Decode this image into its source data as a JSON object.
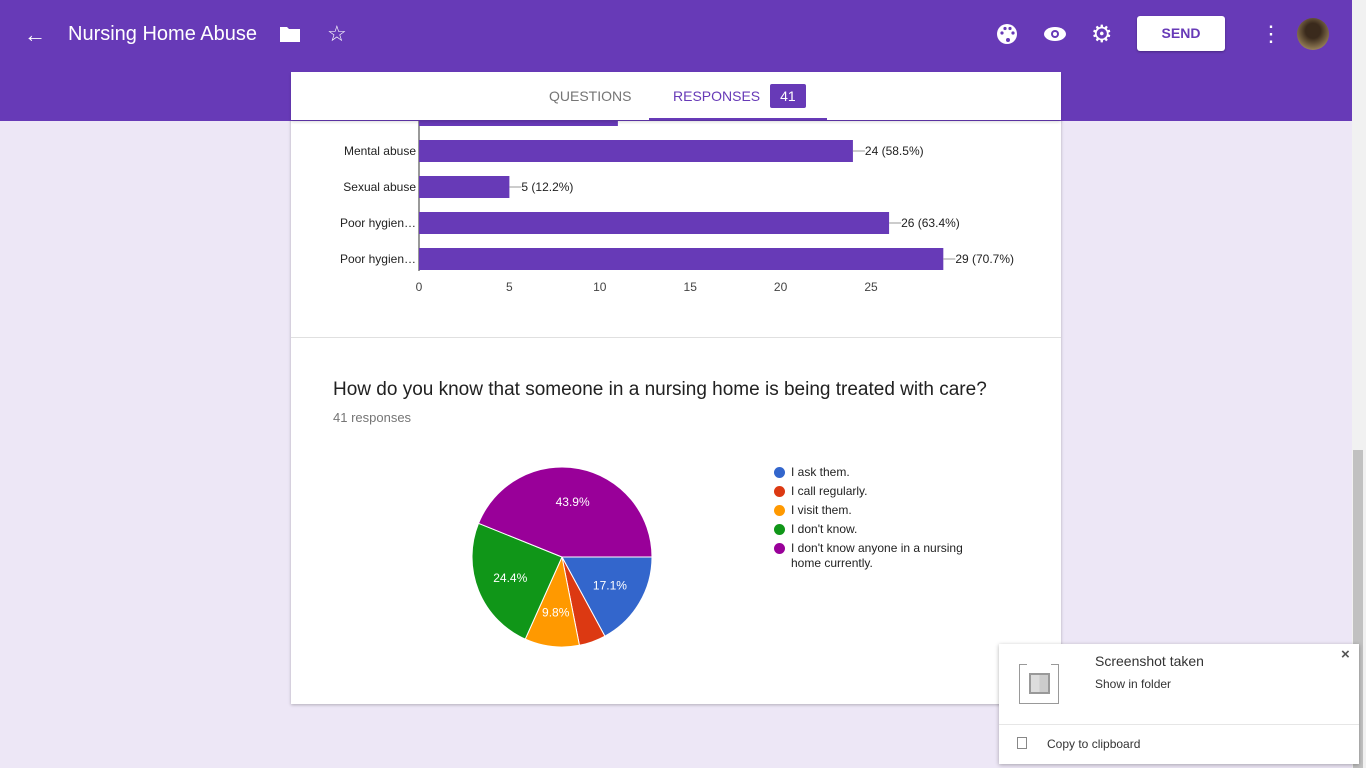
{
  "header": {
    "title": "Nursing Home Abuse",
    "send_label": "SEND",
    "icons": [
      "arrow-back-icon",
      "folder-icon",
      "star-outline-icon",
      "palette-icon",
      "eye-icon",
      "gear-icon",
      "more-vert-icon"
    ],
    "accent": "#673ab7"
  },
  "tabs": [
    {
      "label": "QUESTIONS"
    },
    {
      "label": "RESPONSES",
      "badge": "41",
      "active": true
    }
  ],
  "chart_data": [
    {
      "type": "bar",
      "orientation": "horizontal",
      "categories": [
        "",
        "Mental abuse",
        "Sexual abuse",
        "Poor hygien…",
        "Poor hygien…"
      ],
      "values": [
        11,
        24,
        5,
        26,
        29
      ],
      "labels": [
        "",
        "24 (58.5%)",
        "5 (12.2%)",
        "26 (63.4%)",
        "29 (70.7%)"
      ],
      "xticks": [
        "0",
        "5",
        "10",
        "15",
        "20",
        "25"
      ],
      "xlim": [
        0,
        30
      ],
      "color": "#673ab7"
    },
    {
      "type": "pie",
      "title": "How do you know that someone in a nursing home is being treated with care?",
      "subtitle": "41 responses",
      "slices": [
        {
          "name": "I ask them.",
          "value": 17.1,
          "label": "17.1%",
          "color": "#3366cc"
        },
        {
          "name": "I call regularly.",
          "value": 4.8,
          "label": "",
          "color": "#dc3912"
        },
        {
          "name": "I visit them.",
          "value": 9.8,
          "label": "9.8%",
          "color": "#ff9900"
        },
        {
          "name": "I don't know.",
          "value": 24.4,
          "label": "24.4%",
          "color": "#109618"
        },
        {
          "name": "I don't know anyone in a nursing home currently.",
          "value": 43.9,
          "label": "43.9%",
          "color": "#990099"
        }
      ],
      "legend": "right"
    }
  ],
  "toast": {
    "title": "Screenshot taken",
    "action": "Show in folder",
    "copy": "Copy to clipboard"
  }
}
